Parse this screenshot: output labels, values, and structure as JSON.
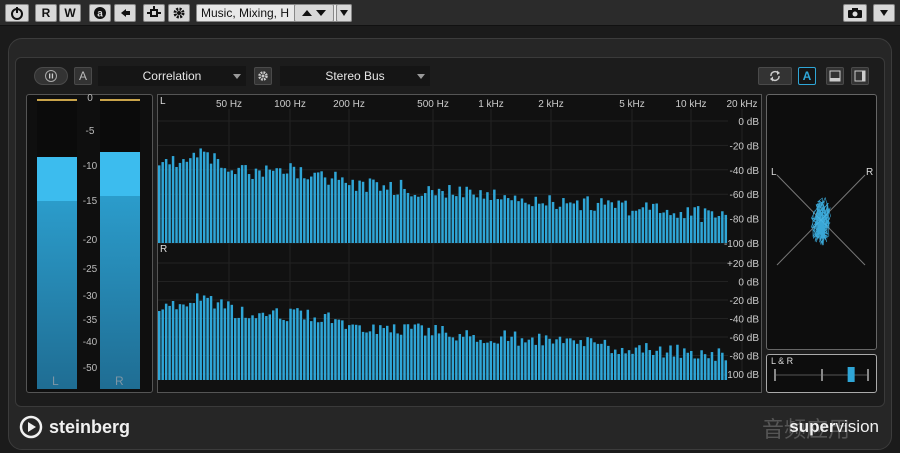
{
  "toolbar": {
    "record_label": "R",
    "write_label": "W",
    "preset_value": "Music, Mixing, H",
    "icons": [
      "power-icon",
      "automation-a-icon",
      "back-arrow-icon",
      "routing-icon",
      "gear-icon",
      "up-down-icon",
      "dropdown-arrow-icon",
      "camera-icon",
      "chevron-down-icon"
    ]
  },
  "plugin": {
    "module_label": "Correlation",
    "source_label": "Stereo Bus",
    "a_label": "A",
    "accent": "#2fa6d7",
    "background": "#262626"
  },
  "meter": {
    "scale": [
      "0",
      "-5",
      "-10",
      "-15",
      "-20",
      "-25",
      "-30",
      "-35",
      "-40",
      "-50"
    ],
    "channels": [
      {
        "label": "L",
        "level_db": -12,
        "peak_db": -7
      },
      {
        "label": "R",
        "level_db": -11,
        "peak_db": -4
      }
    ]
  },
  "spectrum": {
    "freq_labels": [
      "50 Hz",
      "100 Hz",
      "200 Hz",
      "500 Hz",
      "1 kHz",
      "2 kHz",
      "5 kHz",
      "10 kHz",
      "20 kHz"
    ],
    "db_top": [
      "0 dB",
      "-20 dB",
      "-40 dB",
      "-60 dB",
      "-80 dB",
      "-100 dB"
    ],
    "db_bottom": [
      "+20 dB",
      "0 dB",
      "-20 dB",
      "-40 dB",
      "-60 dB",
      "-80 dB",
      "-100 dB"
    ],
    "left_label": "L",
    "right_label": "R"
  },
  "vectorscope": {
    "left_label": "L",
    "right_label": "R",
    "corr_label": "L & R",
    "correlation": 0.62
  },
  "footer": {
    "brand": "steinberg",
    "product_bold": "super",
    "product_light": "vision",
    "watermark": "音频应用"
  }
}
